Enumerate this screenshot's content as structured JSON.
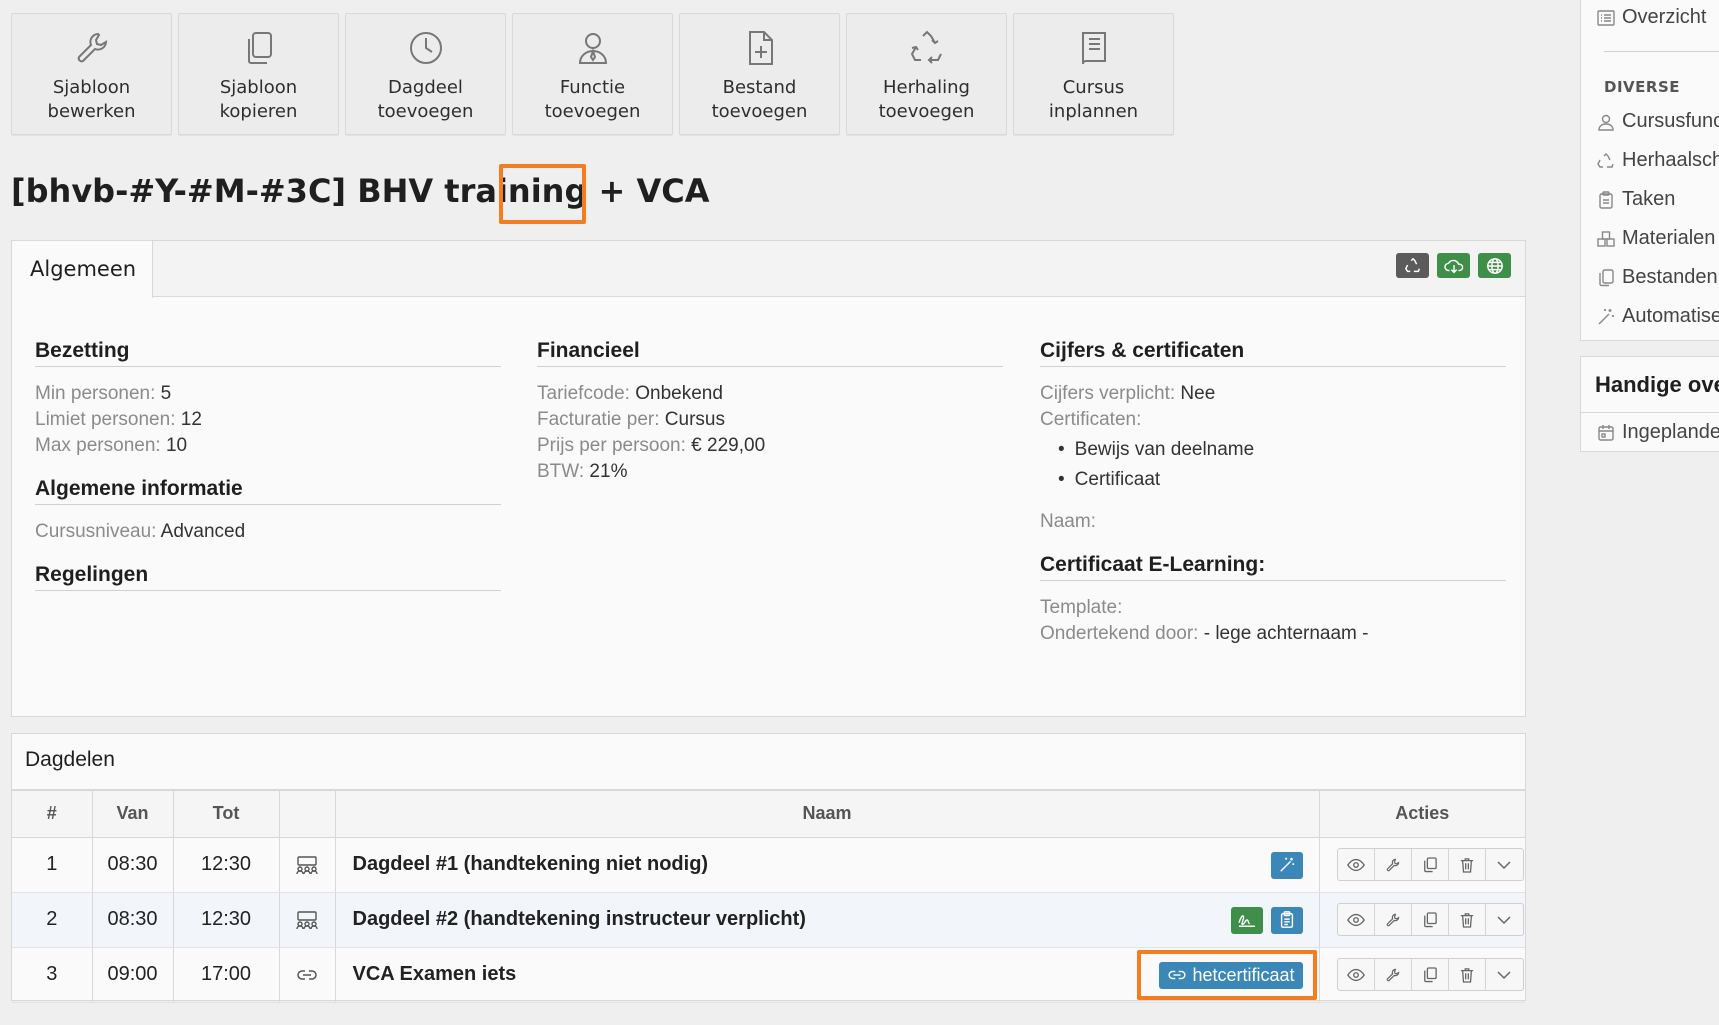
{
  "toolbar": {
    "buttons": [
      {
        "label": "Sjabloon\nbewerken",
        "icon": "wrench-icon"
      },
      {
        "label": "Sjabloon\nkopieren",
        "icon": "copy-icon"
      },
      {
        "label": "Dagdeel\ntoevoegen",
        "icon": "clock-icon"
      },
      {
        "label": "Functie\ntoevoegen",
        "icon": "user-tie-icon"
      },
      {
        "label": "Bestand\ntoevoegen",
        "icon": "file-plus-icon"
      },
      {
        "label": "Herhaling\ntoevoegen",
        "icon": "recycle-icon"
      },
      {
        "label": "Cursus\ninplannen",
        "icon": "book-icon"
      }
    ]
  },
  "page": {
    "title_prefix": "[bhvb-#Y-#M-#3C] BHV training + ",
    "title_highlight": "VCA"
  },
  "general": {
    "tab_label": "Algemeen",
    "bezetting": {
      "heading": "Bezetting",
      "min_k": "Min personen:",
      "min_v": " 5",
      "limiet_k": "Limiet personen:",
      "limiet_v": " 12",
      "max_k": "Max personen:",
      "max_v": " 10"
    },
    "algemene_info": {
      "heading": "Algemene informatie",
      "niveau_k": "Cursusniveau:",
      "niveau_v": " Advanced"
    },
    "regelingen": {
      "heading": "Regelingen"
    },
    "financieel": {
      "heading": "Financieel",
      "tarief_k": "Tariefcode:",
      "tarief_v": " Onbekend",
      "factuur_k": "Facturatie per:",
      "factuur_v": " Cursus",
      "prijs_k": "Prijs per persoon:",
      "prijs_v": " € 229,00",
      "btw_k": "BTW:",
      "btw_v": " 21%"
    },
    "cijfers": {
      "heading": "Cijfers & certificaten",
      "verplicht_k": "Cijfers verplicht:",
      "verplicht_v": " Nee",
      "cert_k": "Certificaten:",
      "certs": [
        "Bewijs van deelname",
        "Certificaat"
      ],
      "naam_k": "Naam:"
    },
    "elearning": {
      "heading": "Certificaat E-Learning:",
      "template_k": "Template:",
      "onderteken_k": "Ondertekend door:",
      "onderteken_v": " - lege achternaam -"
    }
  },
  "dagdelen": {
    "heading": "Dagdelen",
    "columns": {
      "num": "#",
      "van": "Van",
      "tot": "Tot",
      "naam": "Naam",
      "acties": "Acties"
    },
    "rows": [
      {
        "num": "1",
        "van": "08:30",
        "tot": "12:30",
        "naam": "Dagdeel #1 (handtekening niet nodig)"
      },
      {
        "num": "2",
        "van": "08:30",
        "tot": "12:30",
        "naam": "Dagdeel #2 (handtekening instructeur verplicht)"
      },
      {
        "num": "3",
        "van": "09:00",
        "tot": "17:00",
        "naam": "VCA Examen iets",
        "badge": "hetcertificaat"
      }
    ]
  },
  "sidebar": {
    "top_item": "Overzicht",
    "diverse_heading": "DIVERSE",
    "items": [
      "Cursusfunctie",
      "Herhaalschema",
      "Taken",
      "Materialen",
      "Bestanden",
      "Automatisering"
    ],
    "handige_title": "Handige overzichten",
    "handige_items": [
      "Ingeplande cursussen"
    ]
  },
  "colors": {
    "accent_orange": "#f57c1f",
    "badge_blue": "#3a87b8",
    "badge_green": "#3f8f4a",
    "badge_dark": "#5b5b5b"
  }
}
